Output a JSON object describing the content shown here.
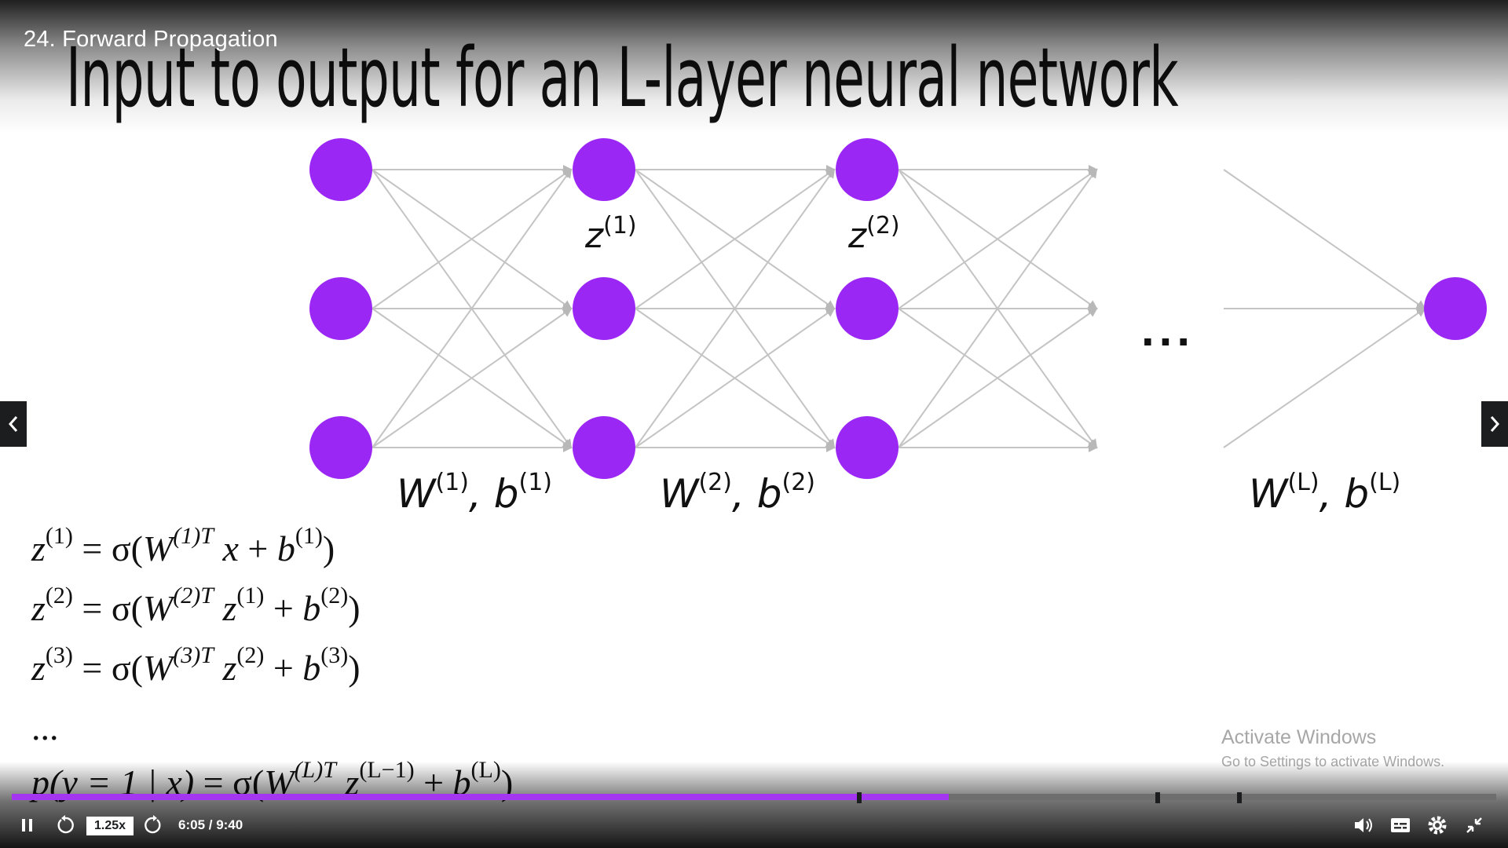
{
  "player": {
    "lecture_title": "24. Forward Propagation",
    "speed": "1.25x",
    "time": "6:05 / 9:40",
    "progress_fraction": 0.631,
    "chapter_marker_fractions": [
      0.571,
      0.772,
      0.827
    ],
    "accent_color": "#a435f0",
    "icons": [
      "pause-icon",
      "rewind-icon",
      "forward-icon",
      "volume-icon",
      "captions-icon",
      "settings-icon",
      "exit-fullscreen-icon",
      "prev-arrow-icon",
      "next-arrow-icon"
    ]
  },
  "slide": {
    "heading": "Input to output for an L-layer neural network",
    "node_color": "#9b27f5",
    "z_labels": [
      {
        "base": "z",
        "sup": "(1)"
      },
      {
        "base": "z",
        "sup": "(2)"
      }
    ],
    "weight_labels": [
      {
        "w": "W",
        "wsup": "(1)",
        "sep": ", ",
        "b": "b",
        "bsup": "(1)"
      },
      {
        "w": "W",
        "wsup": "(2)",
        "sep": ", ",
        "b": "b",
        "bsup": "(2)"
      },
      {
        "w": "W",
        "wsup": "(L)",
        "sep": ", ",
        "b": "b",
        "bsup": "(L)"
      }
    ],
    "ellipsis": "...",
    "equations": [
      {
        "lhs": "z",
        "lhs_sup": "(1)",
        "mid": " = σ(",
        "w": "W",
        "w_sup": "(1)T",
        "input": " x",
        "input_sup": "",
        "plus": " + ",
        "b": "b",
        "b_sup": "(1)",
        "close": ")"
      },
      {
        "lhs": "z",
        "lhs_sup": "(2)",
        "mid": " = σ(",
        "w": "W",
        "w_sup": "(2)T",
        "input": " z",
        "input_sup": "(1)",
        "plus": " + ",
        "b": "b",
        "b_sup": "(2)",
        "close": ")"
      },
      {
        "lhs": "z",
        "lhs_sup": "(3)",
        "mid": " = σ(",
        "w": "W",
        "w_sup": "(3)T",
        "input": " z",
        "input_sup": "(2)",
        "plus": " + ",
        "b": "b",
        "b_sup": "(3)",
        "close": ")"
      }
    ],
    "equation_ellipsis": "...",
    "final_equation": {
      "lhs": "p(y = 1 | x)",
      "mid": " = σ(",
      "w": "W",
      "w_sup": "(L)T",
      "input": " z",
      "input_sup": "(L−1)",
      "plus": " + ",
      "b": "b",
      "b_sup": "(L)",
      "close": ")"
    }
  },
  "watermark": {
    "line1": "Activate Windows",
    "line2": "Go to Settings to activate Windows."
  }
}
